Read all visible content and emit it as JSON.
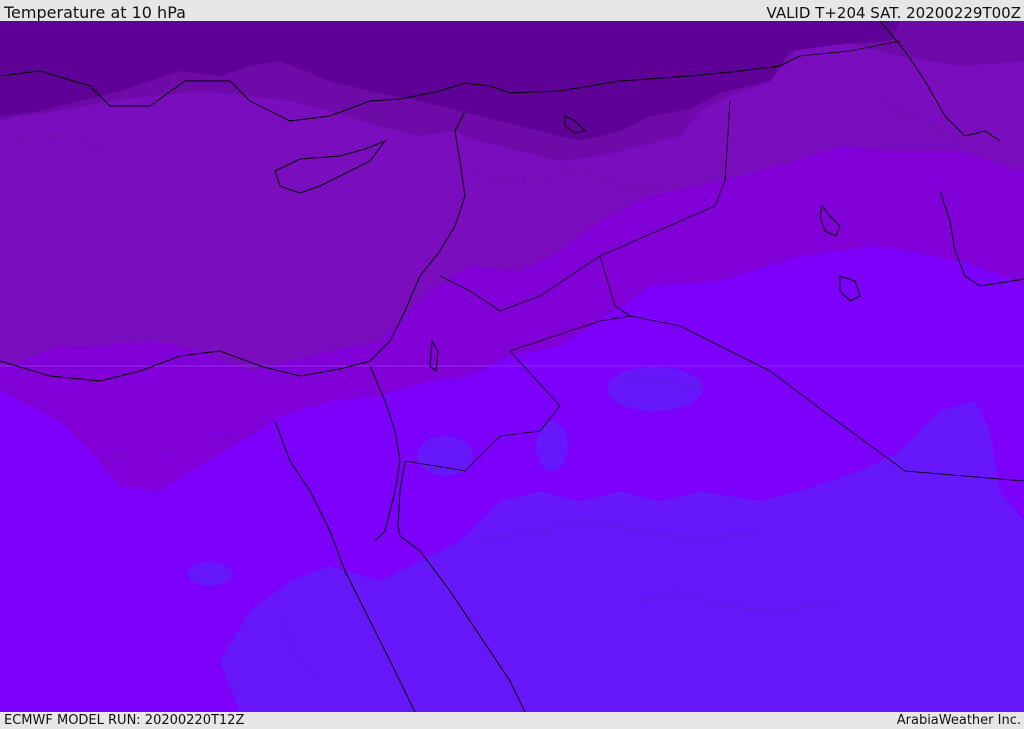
{
  "header": {
    "title": "Temperature at 10 hPa",
    "valid_time": "VALID T+204 SAT. 20200229T00Z"
  },
  "footer": {
    "model_run": "ECMWF MODEL RUN: 20200220T12Z",
    "credit": "ArabiaWeather Inc."
  },
  "colors": {
    "band_coldest": "#5f0096",
    "band_cold": "#6d0aa8",
    "band_mid": "#7a0dbe",
    "band_mild": "#8200d8",
    "band_warm": "#7c00fa",
    "band_warmest": "#6618fa",
    "coastline": "#000000",
    "background": "#e6e6e6"
  }
}
